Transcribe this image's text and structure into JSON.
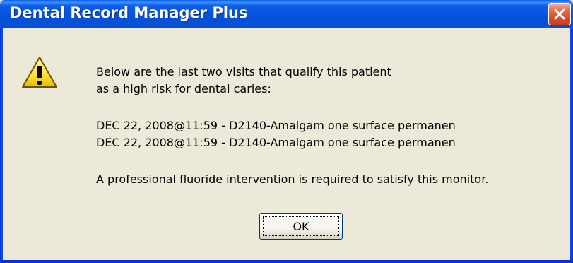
{
  "window": {
    "title": "Dental Record Manager Plus",
    "close_icon": "close-icon",
    "title_color": "#ffffff",
    "titlebar_color": "#0653dc",
    "close_color": "#d4502c"
  },
  "dialog": {
    "icon": "warning-icon",
    "message_lines": [
      "Below are the last two visits that qualify this patient",
      "as a high risk for dental caries:",
      "DEC 22, 2008@11:59 - D2140-Amalgam one surface permanen",
      "DEC 22, 2008@11:59 - D2140-Amalgam one surface permanen",
      "A professional fluoride intervention is required to satisfy this monitor."
    ],
    "ok_label": "OK"
  },
  "colors": {
    "background": "#ece9d8",
    "warning_fill": "#fde23c"
  }
}
